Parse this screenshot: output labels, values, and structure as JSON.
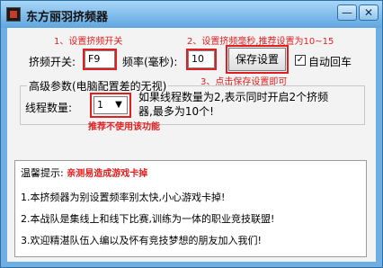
{
  "window": {
    "title": "东方丽羽挤频器",
    "minimize_glyph": "—",
    "close_glyph": "✕"
  },
  "annotations": {
    "set_key": "1、设置挤频开关",
    "set_interval": "2、设置挤频毫秒,推荐设置为10~15",
    "click_save": "3、点击保存设置即可",
    "not_recommended": "推荐不使用该功能"
  },
  "controls": {
    "hotkey_label": "挤频开关:",
    "hotkey_value": "F9",
    "interval_label": "频率(毫秒):",
    "interval_value": "10",
    "save_button": "保存设置",
    "auto_enter_label": "自动回车",
    "auto_enter_checked": true
  },
  "advanced": {
    "group_title": "高级参数(电脑配置差的无视)",
    "threads_label": "线程数量:",
    "threads_value": "1",
    "threads_note_line1": "如果线程数量为2,表示同时开启2个挤频",
    "threads_note_line2": "器,最多为10个!"
  },
  "tips": {
    "heading": "温馨提示:",
    "heading_red": "亲测易造成游戏卡掉",
    "line1": "1.本挤频器为别设置频率别太快,小心游戏卡掉!",
    "line2": "2.本战队是集线上和线下比赛,训练为一体的职业竞技联盟!",
    "line3": "3.欢迎精湛队伍入编以及怀有竞技梦想的朋友加入我们!"
  },
  "icons": {
    "app": "app-icon",
    "dropdown": "chevron-down-icon",
    "checkbox": "checkmark-icon"
  },
  "colors": {
    "annotation": "#e02020",
    "titlebar_top": "#a8d6f8",
    "titlebar_bottom": "#5fa6df"
  }
}
